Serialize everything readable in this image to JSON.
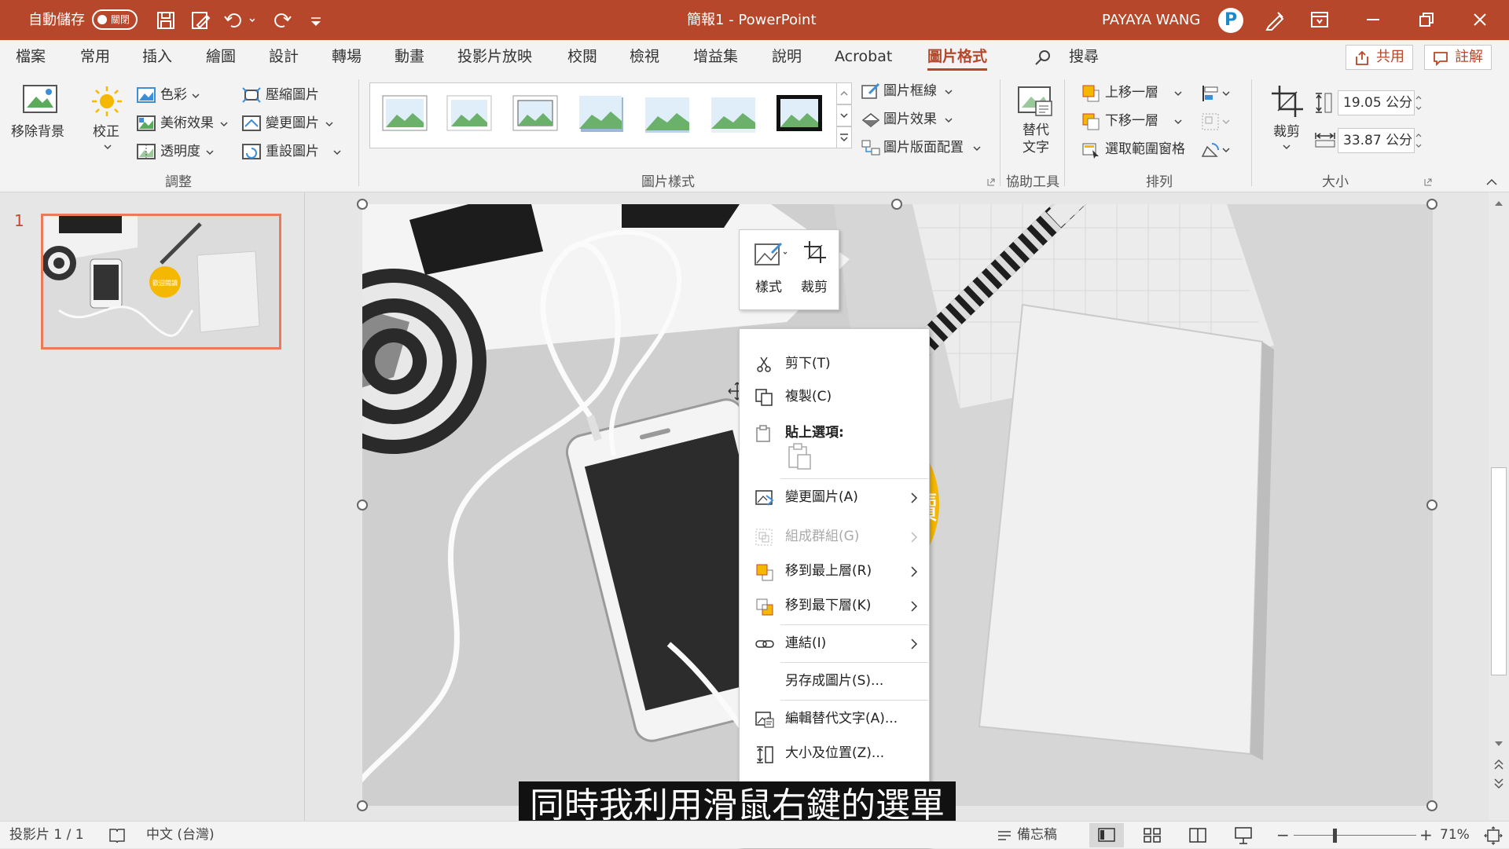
{
  "title_bar": {
    "autosave_label": "自動儲存",
    "autosave_state": "關閉",
    "doc_title": "簡報1  -  PowerPoint",
    "user_name": "PAYAYA WANG",
    "user_initial": "P"
  },
  "tabs": [
    "檔案",
    "常用",
    "插入",
    "繪圖",
    "設計",
    "轉場",
    "動畫",
    "投影片放映",
    "校閱",
    "檢視",
    "增益集",
    "說明",
    "Acrobat",
    "圖片格式"
  ],
  "active_tab": "圖片格式",
  "search_label": "搜尋",
  "share_label": "共用",
  "comments_label": "註解",
  "ribbon": {
    "adjust": {
      "remove_bg": "移除背景",
      "corrections": "校正",
      "color": "色彩",
      "artistic": "美術效果",
      "transparency": "透明度",
      "compress": "壓縮圖片",
      "change": "變更圖片",
      "reset": "重設圖片",
      "group_label": "調整"
    },
    "styles": {
      "border": "圖片框線",
      "effects": "圖片效果",
      "layout": "圖片版面配置",
      "group_label": "圖片樣式"
    },
    "access": {
      "alt_text": "替代\n文字",
      "group_label": "協助工具"
    },
    "arrange": {
      "forward": "上移一層",
      "backward": "下移一層",
      "selection_pane": "選取範圍窗格",
      "group_label": "排列"
    },
    "size": {
      "crop": "裁剪",
      "height": "19.05 公分",
      "width": "33.87 公分",
      "group_label": "大小"
    }
  },
  "slide_pane": {
    "slide_number": "1"
  },
  "slide": {
    "badge_text": "讀",
    "thumb_badge": "歡迎閱讀"
  },
  "mini_toolbar": {
    "style": "樣式",
    "crop": "裁剪"
  },
  "context_menu": {
    "cut": "剪下(T)",
    "copy": "複製(C)",
    "paste_options": "貼上選項:",
    "change_picture": "變更圖片(A)",
    "group": "組成群組(G)",
    "bring_front": "移到最上層(R)",
    "send_back": "移到最下層(K)",
    "link": "連結(I)",
    "save_as": "另存成圖片(S)...",
    "edit_alt": "編輯替代文字(A)...",
    "size_position": "大小及位置(Z)..."
  },
  "status_bar": {
    "slide_info": "投影片 1 / 1",
    "language": "中文 (台灣)",
    "notes": "備忘稿",
    "zoom": "71%"
  },
  "subtitle": "同時我利用滑鼠右鍵的選單",
  "colors": {
    "accent": "#b7472a",
    "badge": "#f5b800"
  }
}
